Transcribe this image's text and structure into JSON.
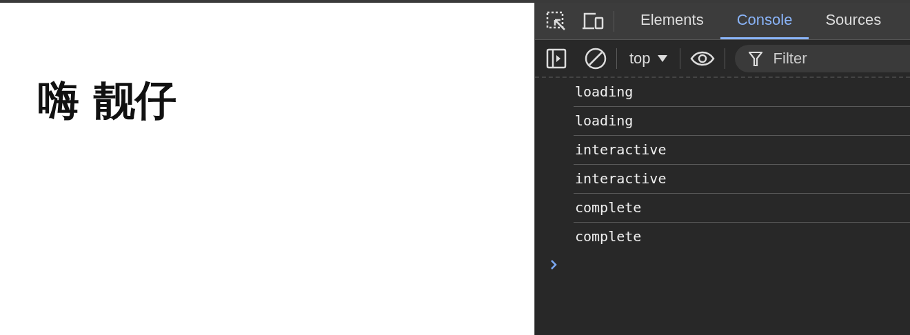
{
  "page": {
    "heading": "嗨 靓仔"
  },
  "devtools": {
    "tabs": [
      {
        "label": "Elements",
        "selected": false
      },
      {
        "label": "Console",
        "selected": true
      },
      {
        "label": "Sources",
        "selected": false
      }
    ],
    "toolbar": {
      "context": "top",
      "filter": {
        "placeholder": "Filter"
      }
    },
    "messages": [
      "loading",
      "loading",
      "interactive",
      "interactive",
      "complete",
      "complete"
    ]
  }
}
